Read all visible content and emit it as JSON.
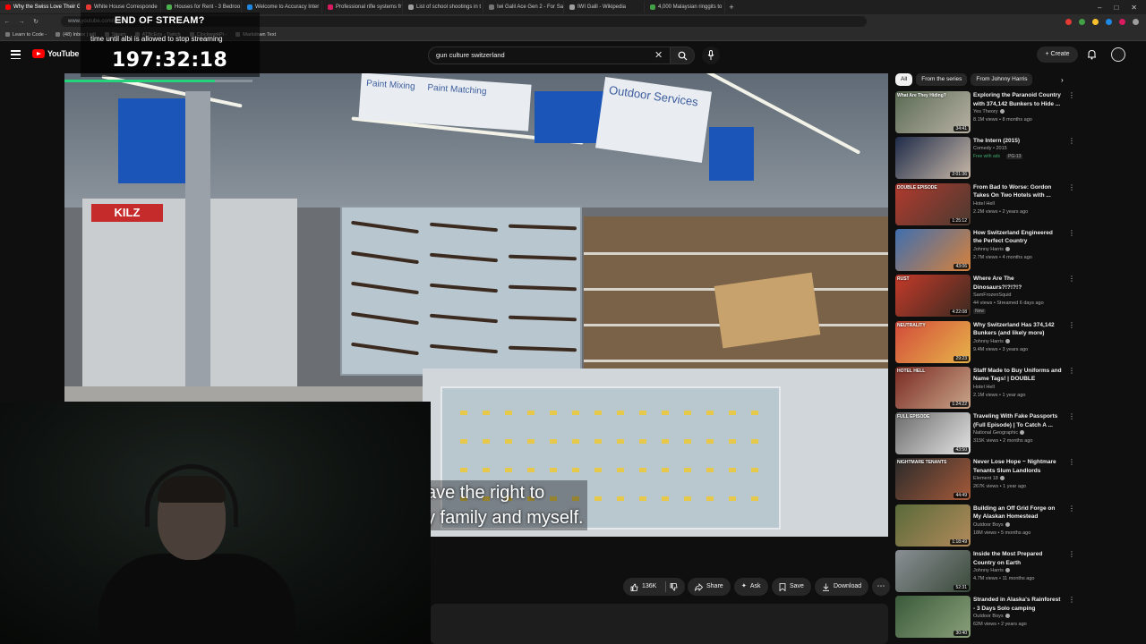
{
  "browser": {
    "tabs": [
      {
        "label": "Why the Swiss Love Their G",
        "color": "#ff0000",
        "active": true
      },
      {
        "label": "White House Corresponde",
        "color": "#e53935"
      },
      {
        "label": "Houses for Rent - 3 Bedroo",
        "color": "#4caf50"
      },
      {
        "label": "Welcome to Accuracy Inter",
        "color": "#1e88e5"
      },
      {
        "label": "Professional rifle systems fr",
        "color": "#d81b60"
      },
      {
        "label": "List of school shootings in t",
        "color": "#9e9e9e"
      },
      {
        "label": "Iwi Galil Ace Gen 2 - For Sa",
        "color": "#757575"
      },
      {
        "label": "IWI Galil - Wikipedia",
        "color": "#9e9e9e"
      },
      {
        "label": "4,000 Malaysian ringgits to",
        "color": "#43a047"
      }
    ],
    "url": "www.youtube.com/watch",
    "bookmarks": [
      "Learn to Code -",
      "(48) Inbox | adi",
      "Steam",
      "ATBcErix - Twitch",
      "ClockworkPi -",
      "Markdown Text"
    ]
  },
  "stream_overlay": {
    "title": "END OF STREAM?",
    "subtitle": "time until albi is allowed to stop streaming",
    "timer": "197:32:18",
    "progress": 0.8,
    "bar_color": "#25d37a"
  },
  "youtube": {
    "logo": "YouTube",
    "search_value": "gun culture switzerland",
    "create_label": "Create"
  },
  "video": {
    "caption_line1": "ave the right to",
    "caption_line2": "y family and myself.",
    "sign_outdoor": "Outdoor Services",
    "sign_paint1": "Paint Mixing",
    "sign_paint2": "Paint Matching",
    "brand_sign": "KILZ"
  },
  "actions": {
    "likes": "136K",
    "share": "Share",
    "ask": "Ask",
    "save": "Save",
    "download": "Download"
  },
  "chips": [
    "All",
    "From the series",
    "From Johnny Harris"
  ],
  "recommendations": [
    {
      "title": "Exploring the Paranoid Country with 374,142 Bunkers to Hide ...",
      "channel": "Yes Theory",
      "verified": true,
      "meta": "8.1M views • 8 months ago",
      "duration": "34:41",
      "thumb_label": "What Are They Hiding?",
      "color1": "#5a6b54",
      "color2": "#b8b2a4"
    },
    {
      "title": "The Intern (2015)",
      "channel": "Comedy • 2015",
      "verified": false,
      "badge": "Free with ads",
      "badge2": "PG-13",
      "duration": "2:01:36",
      "thumb_label": "",
      "color1": "#1f2c4a",
      "color2": "#c9b9a8"
    },
    {
      "title": "From Bad to Worse: Gordon Takes On Two Hotels with ...",
      "channel": "Hotel Hell",
      "verified": false,
      "meta": "2.2M views • 2 years ago",
      "duration": "1:25:12",
      "thumb_label": "DOUBLE EPISODE",
      "color1": "#b23a2e",
      "color2": "#4a3a30"
    },
    {
      "title": "How Switzerland Engineered the Perfect Country",
      "channel": "Johnny Harris",
      "verified": true,
      "meta": "2.7M views • 4 months ago",
      "duration": "43:06",
      "thumb_label": "",
      "color1": "#3f6fb0",
      "color2": "#d7813a"
    },
    {
      "title": "Where Are The Dinosaurs?!?!?!?",
      "channel": "SamFrozenSquid",
      "verified": false,
      "meta": "44 views • Streamed 6 days ago",
      "badge": "New",
      "duration": "4:22:08",
      "thumb_label": "RUST",
      "color1": "#c53a2a",
      "color2": "#3a2a20"
    },
    {
      "title": "Why Switzerland Has 374,142 Bunkers (and likely more)",
      "channel": "Johnny Harris",
      "verified": true,
      "meta": "9.4M views • 3 years ago",
      "duration": "29:23",
      "thumb_label": "NEUTRALITY",
      "color1": "#d24a3a",
      "color2": "#e7b44a"
    },
    {
      "title": "Staff Made to Buy Uniforms and Name Tags! | DOUBLE EPISOD...",
      "channel": "Hotel Hell",
      "verified": false,
      "meta": "2.1M views • 1 year ago",
      "duration": "1:24:22",
      "thumb_label": "HOTEL HELL",
      "color1": "#7a2a22",
      "color2": "#c9a58a"
    },
    {
      "title": "Traveling With Fake Passports (Full Episode) | To Catch A ...",
      "channel": "National Geographic",
      "verified": true,
      "meta": "315K views • 2 months ago",
      "duration": "43:50",
      "thumb_label": "FULL EPISODE",
      "color1": "#6b6b6b",
      "color2": "#e4e4e4"
    },
    {
      "title": "Never Lose Hope ~ Nightmare Tenants Slum Landlords",
      "channel": "Element 18",
      "verified": true,
      "meta": "267K views • 1 year ago",
      "duration": "44:49",
      "thumb_label": "NIGHTMARE TENANTS",
      "color1": "#2a2a2a",
      "color2": "#a55a3a"
    },
    {
      "title": "Building an Off Grid Forge on My Alaskan Homestead",
      "channel": "Outdoor Boys",
      "verified": true,
      "meta": "18M views • 5 months ago",
      "duration": "1:18:49",
      "thumb_label": "",
      "color1": "#5a6a3a",
      "color2": "#b28a5a"
    },
    {
      "title": "Inside the Most Prepared Country on Earth",
      "channel": "Johnny Harris",
      "verified": true,
      "meta": "4.7M views • 11 months ago",
      "duration": "52:31",
      "thumb_label": "",
      "color1": "#8a8f94",
      "color2": "#3a4a3a"
    },
    {
      "title": "Stranded in Alaska's Rainforest - 3 Days Solo camping",
      "channel": "Outdoor Boys",
      "verified": true,
      "meta": "62M views • 2 years ago",
      "duration": "30:40",
      "thumb_label": "",
      "color1": "#3a5a3a",
      "color2": "#8aa07a"
    }
  ]
}
